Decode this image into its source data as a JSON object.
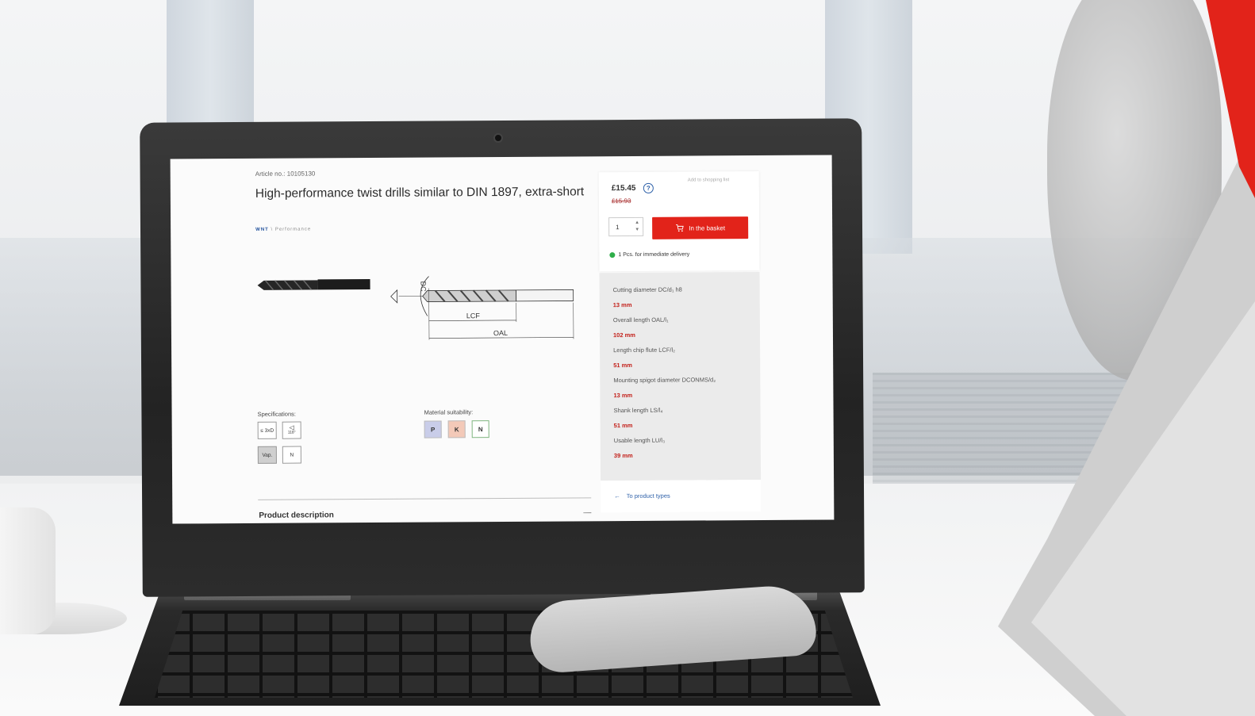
{
  "product": {
    "article_no": "Article no.: 10105130",
    "title": "High-performance twist drills similar to DIN 1897, extra-short",
    "brand": "WNT",
    "brand_line": "\\ Performance"
  },
  "diagram": {
    "dc": "DC",
    "lcf": "LCF",
    "oal": "OAL"
  },
  "specifications": {
    "heading": "Specifications:",
    "items": [
      "≤ 3xD",
      "118°",
      "Vap.",
      "N"
    ]
  },
  "material": {
    "heading": "Material suitability:",
    "items": [
      "P",
      "K",
      "N"
    ],
    "colors": [
      "#c9cde9",
      "#f3c9b8",
      "#ffffff"
    ]
  },
  "pricing": {
    "current": "£15.45",
    "old": "£15.93",
    "wishlist": "Add to shopping list",
    "quantity": "1",
    "basket_label": "In the basket",
    "availability": "1 Pcs. for immediate delivery"
  },
  "specs": [
    {
      "label": "Cutting diameter DC/d₁ h8",
      "value": "13 mm"
    },
    {
      "label": "Overall length OAL/l₁",
      "value": "102 mm"
    },
    {
      "label": "Length chip flute LCF/l₂",
      "value": "51 mm"
    },
    {
      "label": "Mounting spigot diameter DCONMS/d₂",
      "value": "13 mm"
    },
    {
      "label": "Shank length LS/l₄",
      "value": "51 mm"
    },
    {
      "label": "Usable length LU/l₃",
      "value": "39 mm"
    }
  ],
  "back_link": "To product types",
  "description_label": "Product description",
  "colors": {
    "accent_red": "#e2231a",
    "brand_blue": "#2c5fa8",
    "available_green": "#2fae4a"
  }
}
